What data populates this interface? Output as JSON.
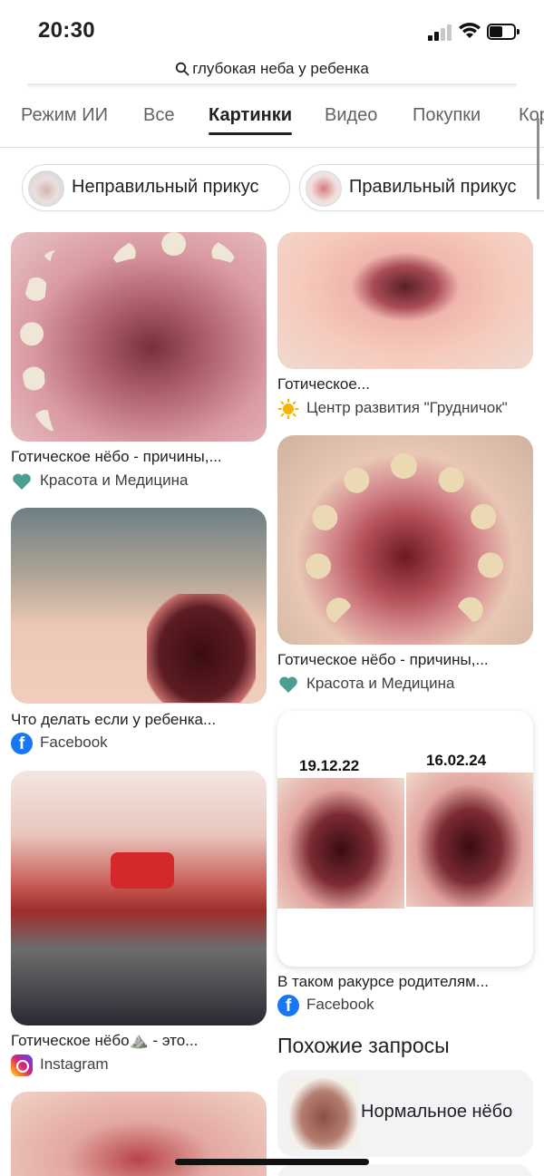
{
  "status": {
    "time": "20:30"
  },
  "url": {
    "query": "глубокая неба у ребенка"
  },
  "tabs": [
    {
      "label": "Режим ИИ"
    },
    {
      "label": "Все"
    },
    {
      "label": "Картинки"
    },
    {
      "label": "Видео"
    },
    {
      "label": "Покупки"
    },
    {
      "label": "Кор"
    }
  ],
  "chips": [
    {
      "label": "Неправильный прикус"
    },
    {
      "label": "Правильный прикус"
    }
  ],
  "results": {
    "left": [
      {
        "caption": "Готическое нёбо - причины,...",
        "source": "Красота и Медицина",
        "icon": "heart-icon"
      },
      {
        "caption": "Что делать если у ребенка...",
        "source": "Facebook",
        "icon": "facebook-icon"
      },
      {
        "caption": "Готическое нёбо⛰️ - это...",
        "source": "Instagram",
        "icon": "instagram-icon"
      }
    ],
    "right": [
      {
        "caption": "Готическое...",
        "source": "Центр развития \"Грудничок\"",
        "icon": "sun-icon"
      },
      {
        "caption": "Готическое нёбо - причины,...",
        "source": "Красота и Медицина",
        "icon": "heart-icon"
      },
      {
        "caption": "В таком ракурсе родителям...",
        "source": "Facebook",
        "icon": "facebook-icon",
        "dates": [
          "19.12.22",
          "16.02.24"
        ]
      }
    ]
  },
  "related": {
    "title": "Похожие запросы",
    "items": [
      {
        "label": "Нормальное нёбо"
      }
    ]
  },
  "colors": {
    "teal_heart": "#4a9e92",
    "facebook": "#1877f2",
    "active_tab": "#202124",
    "muted_tab": "#5f6368"
  }
}
